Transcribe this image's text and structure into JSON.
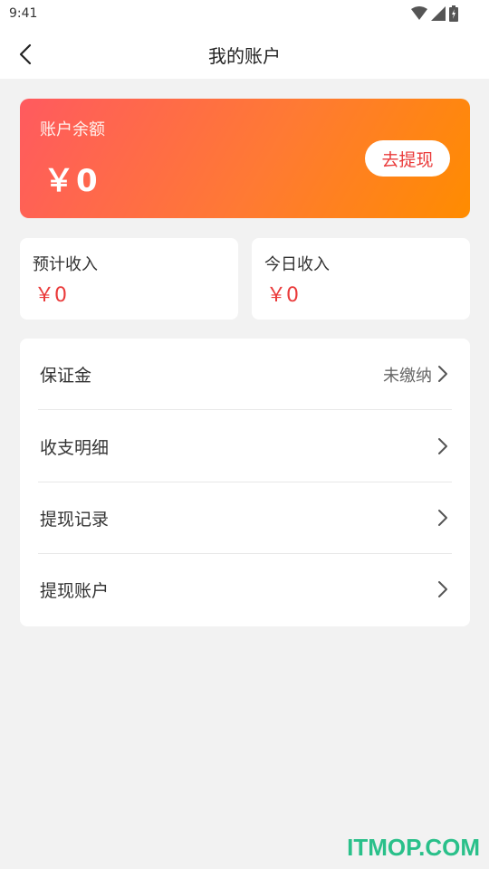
{
  "status_bar": {
    "time": "9:41",
    "icons": [
      "wifi-icon",
      "signal-icon",
      "battery-icon"
    ]
  },
  "nav": {
    "title": "我的账户",
    "back_icon": "back-arrow-icon"
  },
  "balance": {
    "label": "账户余额",
    "amount": "￥0",
    "withdraw_label": "去提现"
  },
  "income": [
    {
      "label": "预计收入",
      "value": "￥0"
    },
    {
      "label": "今日收入",
      "value": "￥0"
    }
  ],
  "menu": {
    "items": [
      {
        "label": "保证金",
        "extra": "未缴纳"
      },
      {
        "label": "收支明细",
        "extra": ""
      },
      {
        "label": "提现记录",
        "extra": ""
      },
      {
        "label": "提现账户",
        "extra": ""
      }
    ]
  },
  "watermark": "ITMOP.COM",
  "colors": {
    "accent_red": "#ea3a3a",
    "card_gradient_start": "#ff5a5f",
    "card_gradient_end": "#ff8c00",
    "watermark": "#2ac08a"
  }
}
